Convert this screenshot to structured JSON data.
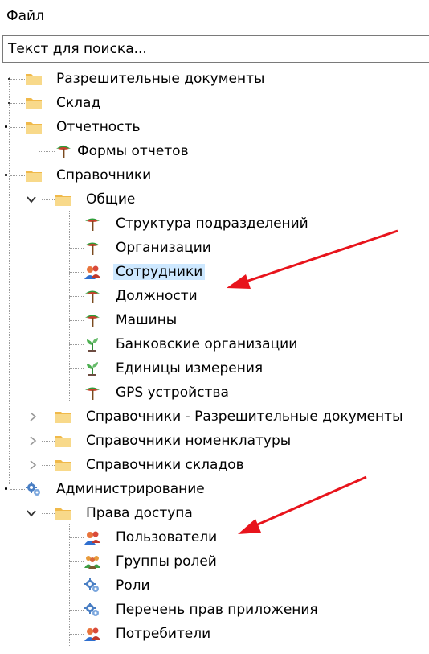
{
  "menu": {
    "file": "Файл"
  },
  "search": {
    "text": "Текст для поиска..."
  },
  "tree": {
    "permits": "Разрешительные документы",
    "warehouse": "Склад",
    "reports": "Отчетность",
    "report_forms": "Формы отчетов",
    "references": "Справочники",
    "general": "Общие",
    "structure": "Структура подразделений",
    "organizations": "Организации",
    "employees": "Сотрудники",
    "positions": "Должности",
    "machines": "Машины",
    "banks": "Банковские организации",
    "units": "Единицы измерения",
    "gps": "GPS устройства",
    "ref_permits": "Справочники - Разрешительные документы",
    "ref_nomenclature": "Справочники номенклатуры",
    "ref_warehouses": "Справочники складов",
    "administration": "Администрирование",
    "access_rights": "Права доступа",
    "users": "Пользователи",
    "role_groups": "Группы ролей",
    "roles": "Роли",
    "app_rights": "Перечень прав приложения",
    "consumers": "Потребители"
  },
  "selected_item": "employees",
  "colors": {
    "arrow": "#e8141c",
    "selection": "#cde8ff",
    "folder": "#f5c86a"
  }
}
